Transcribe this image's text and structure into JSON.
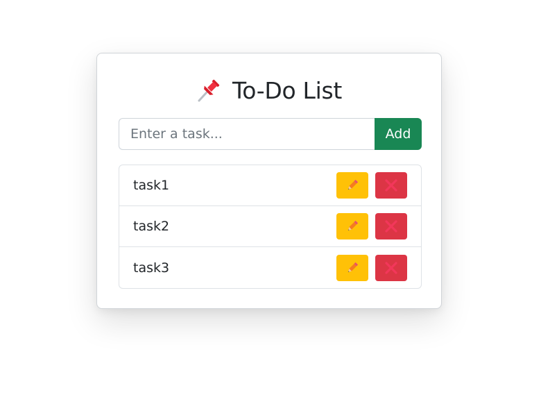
{
  "app": {
    "title": "To-Do List",
    "title_icon": "pushpin-icon"
  },
  "input": {
    "value": "",
    "placeholder": "Enter a task..."
  },
  "add_button": {
    "label": "Add"
  },
  "tasks": [
    {
      "text": "task1"
    },
    {
      "text": "task2"
    },
    {
      "text": "task3"
    }
  ],
  "task_actions": {
    "edit_icon": "pencil-icon",
    "delete_icon": "cross-icon"
  },
  "colors": {
    "add": "#198754",
    "edit": "#ffc107",
    "delete": "#dc3545"
  }
}
